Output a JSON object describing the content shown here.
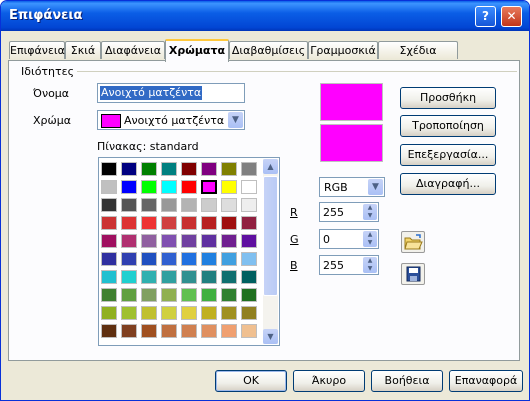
{
  "window": {
    "title": "Επιφάνεια"
  },
  "titlebar_buttons": {
    "help": "?",
    "close": "✕"
  },
  "tabs": [
    {
      "label": "Επιφάνεια",
      "active": false
    },
    {
      "label": "Σκιά",
      "active": false
    },
    {
      "label": "Διαφάνεια",
      "active": false
    },
    {
      "label": "Χρώματα",
      "active": true
    },
    {
      "label": "Διαβαθμίσεις",
      "active": false
    },
    {
      "label": "Γραμμοσκιά",
      "active": false
    },
    {
      "label": "Σχέδια Bitmap",
      "active": false
    }
  ],
  "properties": {
    "group_label": "Ιδιότητες",
    "name_label": "Όνομα",
    "name_value": "Ανοιχτό ματζέντα",
    "color_label": "Χρώμα",
    "color_value": "Ανοιχτό ματζέντα",
    "color_hex": "#ff00ff",
    "table_label": "Πίνακας: standard"
  },
  "palette": [
    [
      "#000000",
      "#000080",
      "#008000",
      "#008080",
      "#800000",
      "#800080",
      "#808000",
      "#808080"
    ],
    [
      "#c0c0c0",
      "#0000ff",
      "#00ff00",
      "#00ffff",
      "#ff0000",
      "#ff00ff",
      "#ffff00",
      "#ffffff"
    ],
    [
      "#333333",
      "#555555",
      "#666666",
      "#999999",
      "#b3b3b3",
      "#cccccc",
      "#dddddd",
      "#eeeeee"
    ],
    [
      "#cc3333",
      "#dd3333",
      "#ee3333",
      "#d04040",
      "#c83030",
      "#b82020",
      "#a01010",
      "#902040"
    ],
    [
      "#a01060",
      "#b03070",
      "#9060a0",
      "#8050b0",
      "#7040a0",
      "#6030a0",
      "#702090",
      "#6010a0"
    ],
    [
      "#3030a0",
      "#3040b0",
      "#2050c0",
      "#3060d0",
      "#2070e0",
      "#2080e0",
      "#40a0e0",
      "#80c0f0"
    ],
    [
      "#20c0d0",
      "#20d0d0",
      "#30b0b0",
      "#30a0a0",
      "#309090",
      "#208080",
      "#107070",
      "#006060"
    ],
    [
      "#408030",
      "#60a040",
      "#80a060",
      "#90b050",
      "#60c050",
      "#40b040",
      "#308030",
      "#207020"
    ],
    [
      "#90b020",
      "#a0c030",
      "#c0c030",
      "#d0d040",
      "#e0d040",
      "#c0b020",
      "#a09020",
      "#908020"
    ],
    [
      "#603010",
      "#804020",
      "#a05020",
      "#c07040",
      "#d08050",
      "#e09060",
      "#f0a070",
      "#f0c090"
    ]
  ],
  "selected_swatch": {
    "row": 1,
    "col": 5
  },
  "color_model": {
    "value": "RGB"
  },
  "rgb": [
    {
      "label": "R",
      "value": "255"
    },
    {
      "label": "G",
      "value": "0"
    },
    {
      "label": "B",
      "value": "255"
    }
  ],
  "side_buttons": {
    "add": "Προσθήκη",
    "modify": "Τροποποίηση",
    "edit": "Επεξεργασία...",
    "delete": "Διαγραφή..."
  },
  "icon_buttons": {
    "open": "folder-open-icon",
    "save": "floppy-disk-icon"
  },
  "bottom_buttons": {
    "ok": "OK",
    "cancel": "Άκυρο",
    "help": "Βοήθεια",
    "reset": "Επαναφορά"
  }
}
